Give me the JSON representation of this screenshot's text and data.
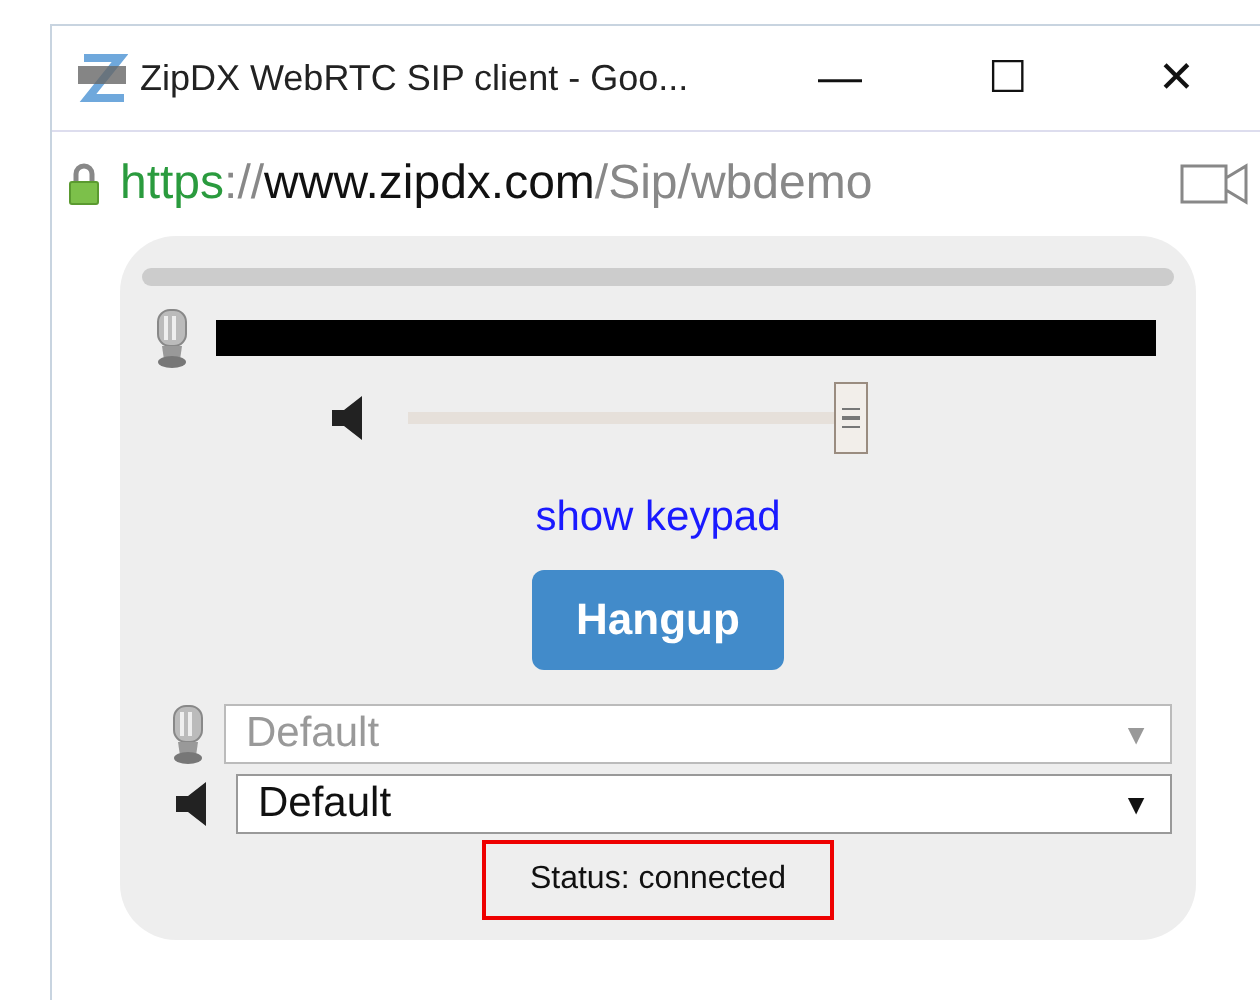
{
  "window": {
    "title": "ZipDX WebRTC SIP client - Goo...",
    "controls": [
      "—",
      "☐",
      "✕"
    ]
  },
  "address_bar": {
    "scheme": "https",
    "separator": "://",
    "host": "www.zipdx.com",
    "path": "/Sip/wbdemo",
    "secure": true
  },
  "volume_slider": {
    "level": 1
  },
  "keypad_link": "show keypad",
  "hangup_button": "Hangup",
  "selects": [
    {
      "kind": "microphone",
      "value": "Default",
      "arrow": "▼",
      "disabled": true
    },
    {
      "kind": "speaker",
      "value": "Default",
      "arrow": "▼",
      "disabled": false
    }
  ],
  "status": "Status: connected"
}
